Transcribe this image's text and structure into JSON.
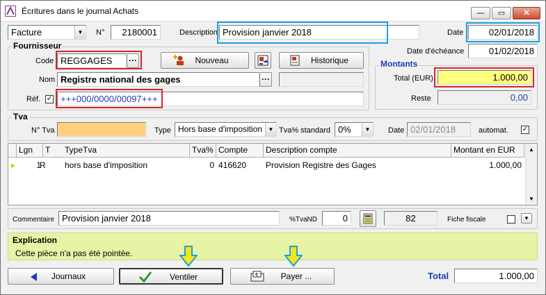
{
  "window": {
    "title": "Écritures dans le journal Achats",
    "min": "—",
    "max": "▭",
    "close": "✕"
  },
  "header": {
    "doc_type": "Facture",
    "n_label": "N°",
    "number": "2180001",
    "description_label": "Description",
    "description": "Provision janvier 2018",
    "date_label": "Date",
    "date": "02/01/2018"
  },
  "fournisseur": {
    "group_title": "Fournisseur",
    "code_label": "Code",
    "code": "REGGAGES",
    "ellipsis": "···",
    "nouveau_label": "Nouveau",
    "historique_label": "Historique",
    "nom_label": "Nom",
    "nom": "Registre national des gages",
    "ref_label": "Réf.",
    "ref_checked": "✓",
    "ref": "+++000/0000/00097+++"
  },
  "echeance": {
    "label": "Date d'échéance",
    "value": "01/02/2018"
  },
  "montants": {
    "title": "Montants",
    "total_label": "Total (EUR)",
    "total": "1.000,00",
    "reste_label": "Reste",
    "reste": "0,00"
  },
  "tva": {
    "title": "Tva",
    "ntva_label": "N° Tva",
    "ntva": "",
    "type_label": "Type",
    "type": "Hors base d'imposition",
    "std_label": "Tva% standard",
    "std": "0%",
    "date_label": "Date",
    "date": "02/01/2018",
    "automat_label": "automat.",
    "automat_checked": "✓"
  },
  "grid": {
    "headers": [
      "Lgn",
      "T",
      "TypeTva",
      "Tva%",
      "Compte",
      "Description compte",
      "Montant en EUR"
    ],
    "rows": [
      {
        "lgn": "1",
        "t": "R",
        "typetva": "hors base d'imposition",
        "tva": "0",
        "compte": "416620",
        "description": "Provision Registre des Gages",
        "montant": "1.000,00"
      }
    ]
  },
  "footer_fields": {
    "commentaire_label": "Commentaire",
    "commentaire": "Provision janvier 2018",
    "tvand_label": "%TvaND",
    "tvand": "0",
    "count": "82",
    "fiche_label": "Fiche fiscale"
  },
  "explication": {
    "title": "Explication",
    "text": "Cette pièce n'a pas été pointée."
  },
  "buttons": {
    "journaux": "Journaux",
    "ventiler": "Ventiler",
    "payer": "Payer ..."
  },
  "total": {
    "label": "Total",
    "value": "1.000,00"
  },
  "colors": {
    "red_highlight": "#d6262d",
    "blue_highlight": "#1aa0e0",
    "arrow": "#f5e61a",
    "total_label": "#1f3fb0"
  }
}
